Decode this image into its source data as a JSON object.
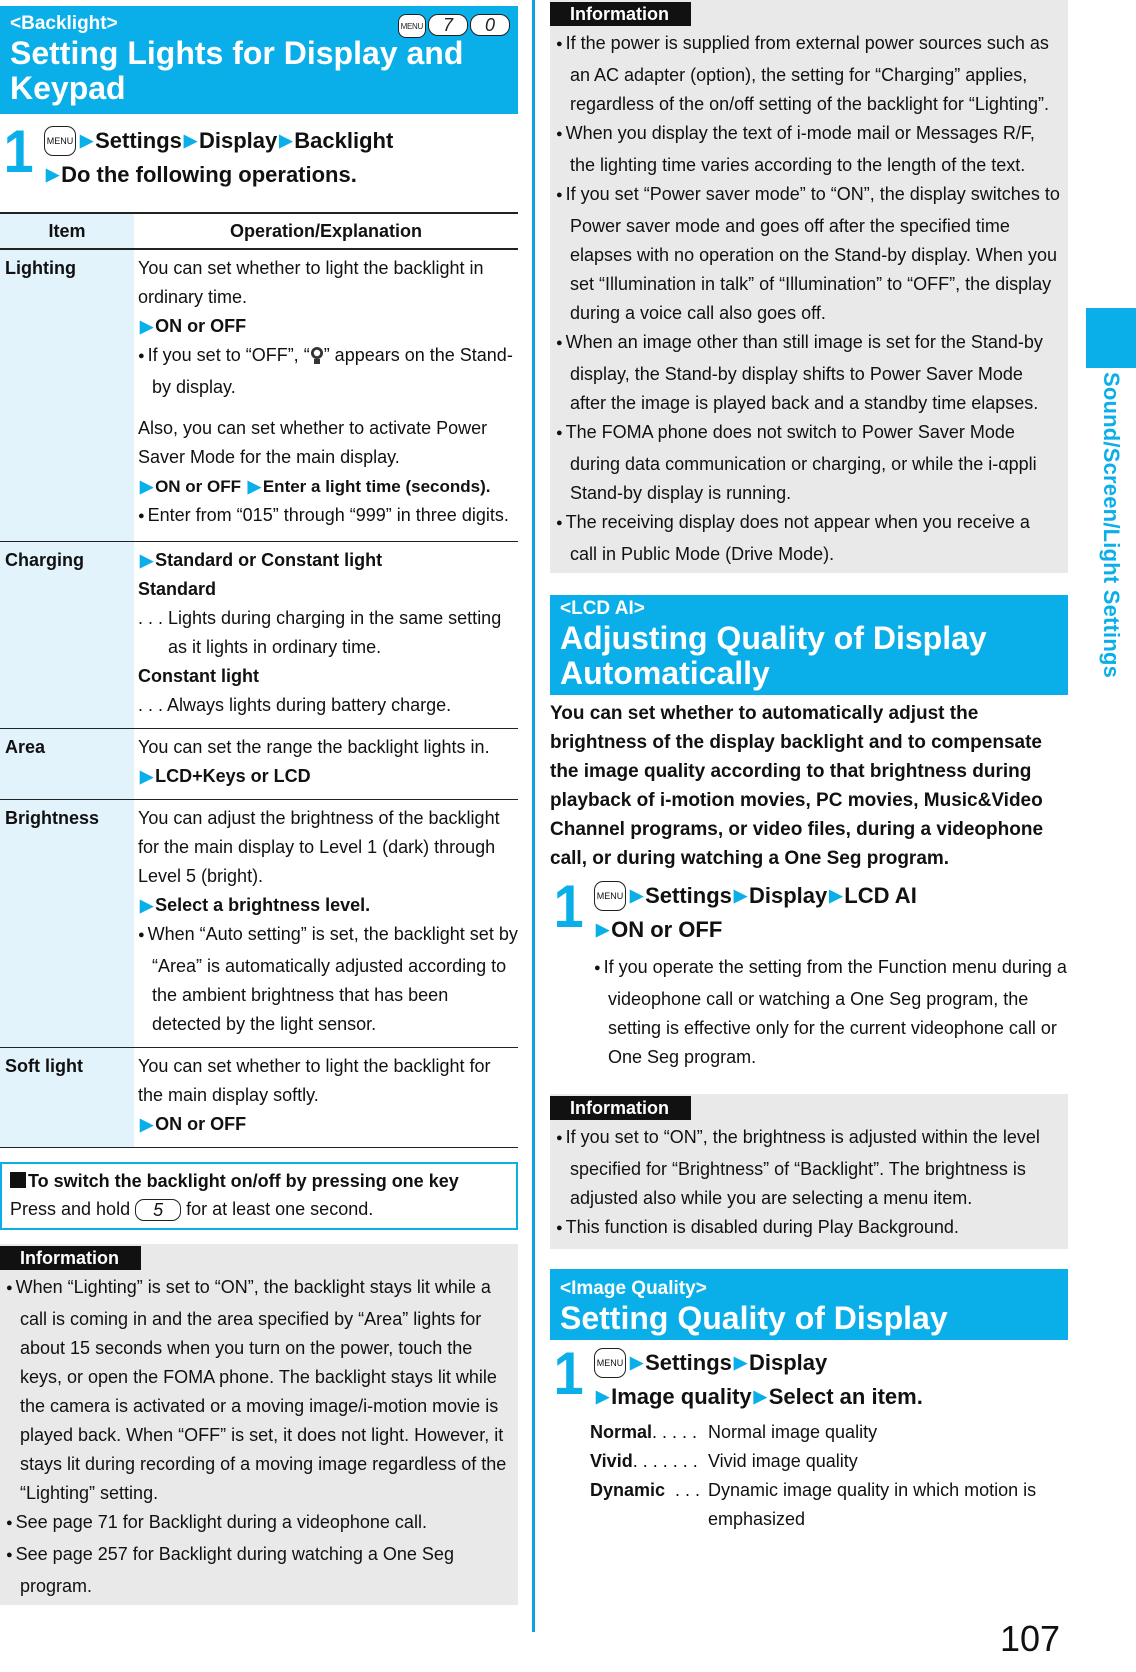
{
  "left": {
    "banner": {
      "tag": "<Backlight>",
      "title": "Setting Lights for Display and Keypad",
      "shortcut_keys": [
        "MENU",
        "7",
        "0"
      ]
    },
    "step": {
      "number": "1",
      "menu_key": "MENU",
      "path": [
        "Settings",
        "Display",
        "Backlight"
      ],
      "action": "Do the following operations."
    },
    "table": {
      "headers": [
        "Item",
        "Operation/Explanation"
      ],
      "rows": {
        "lighting": {
          "item": "Lighting",
          "desc1": "You can set whether to light the backlight in ordinary time.",
          "op1": "ON or OFF",
          "note1_before": "If you set to “OFF”, “",
          "note1_after": "” appears on the Stand-by display.",
          "desc2": "Also, you can set whether to activate Power Saver Mode for the main display.",
          "op2a": "ON or OFF",
          "op2b": "Enter a light time (seconds).",
          "note2": "Enter from “015” through “999” in three digits."
        },
        "charging": {
          "item": "Charging",
          "op": "Standard or Constant light",
          "opt1": "Standard",
          "opt1_desc": ". . . Lights during charging in the same setting as it lights in ordinary time.",
          "opt2": "Constant light",
          "opt2_desc": ". . . Always lights during battery charge."
        },
        "area": {
          "item": "Area",
          "desc": "You can set the range the backlight lights in.",
          "op": "LCD+Keys or LCD"
        },
        "brightness": {
          "item": "Brightness",
          "desc": "You can adjust the brightness of the backlight for the main display to Level 1 (dark) through Level 5 (bright).",
          "op": "Select a brightness level.",
          "note": "When “Auto setting” is set, the backlight set by “Area” is automatically adjusted according to the ambient brightness that has been detected by the light sensor."
        },
        "soft_light": {
          "item": "Soft light",
          "desc": "You can set whether to light the backlight for the main display softly.",
          "op": "ON or OFF"
        }
      }
    },
    "tip": {
      "heading": "To switch the backlight on/off by pressing one key",
      "before_key": "Press and hold",
      "key": "5",
      "after_key": "for at least one second."
    },
    "info": {
      "label": "Information",
      "bullets": [
        "When “Lighting” is set to “ON”, the backlight stays lit while a call is coming in and the area specified by “Area” lights for about 15 seconds when you turn on the power, touch the keys, or open the FOMA phone. The backlight stays lit while the camera is activated or a moving image/i-motion movie is played back. When “OFF” is set, it does not light. However, it stays lit during recording of a moving image regardless of the “Lighting” setting.",
        "See page 71 for Backlight during a videophone call.",
        "See page 257 for Backlight during watching a One Seg program."
      ]
    }
  },
  "right": {
    "info_top": {
      "label": "Information",
      "bullets": [
        "If the power is supplied from external power sources such as an AC adapter (option), the setting for “Charging” applies, regardless of the on/off setting of the backlight for “Lighting”.",
        "When you display the text of i-mode mail or Messages R/F, the lighting time varies according to the length of the text.",
        "If you set “Power saver mode” to “ON”, the display switches to Power saver mode and goes off after the specified time elapses with no operation on the Stand-by display. When you set “Illumination in talk” of “Illumination” to “OFF”, the display during a voice call also goes off.",
        "When an image other than still image is set for the Stand-by display, the Stand-by display shifts to Power Saver Mode after the image is played back and a standby time elapses.",
        "The FOMA phone does not switch to Power Saver Mode during data communication or charging, or while the i-αppli Stand-by display is running.",
        "The receiving display does not appear when you receive a call in Public Mode (Drive Mode)."
      ]
    },
    "lcd_ai": {
      "banner_tag": "<LCD AI>",
      "banner_title": "Adjusting Quality of Display Automatically",
      "intro": "You can set whether to automatically adjust the brightness of the display backlight and to compensate the image quality according to that brightness during playback of i-motion movies, PC movies, Music&Video Channel programs, or video files, during a videophone call, or during watching a One Seg program.",
      "step_number": "1",
      "menu_key": "MENU",
      "path": [
        "Settings",
        "Display",
        "LCD AI"
      ],
      "action": "ON or OFF",
      "note": "If you operate the setting from the Function menu during a videophone call or watching a One Seg program, the setting is effective only for the current videophone call or One Seg program."
    },
    "info_mid": {
      "label": "Information",
      "bullets": [
        "If you set to “ON”, the brightness is adjusted within the level specified for “Brightness” of “Backlight”. The brightness is adjusted also while you are selecting a menu item.",
        "This function is disabled during Play Background."
      ]
    },
    "image_quality": {
      "banner_tag": "<Image Quality>",
      "banner_title": "Setting Quality of Display",
      "step_number": "1",
      "menu_key": "MENU",
      "path": [
        "Settings",
        "Display"
      ],
      "path2": [
        "Image quality",
        "Select an item."
      ],
      "options": [
        {
          "name": "Normal",
          "dots": ". . . . .",
          "desc": "Normal image quality"
        },
        {
          "name": "Vivid",
          "dots": ". . . . . . .",
          "desc": "Vivid image quality"
        },
        {
          "name": "Dynamic",
          "dots": "  . . .",
          "desc": "Dynamic image quality in which motion is emphasized"
        }
      ]
    }
  },
  "side_label": "Sound/Screen/Light Settings",
  "page_number": "107",
  "colors": {
    "accent": "#0aaee8",
    "item_column_bg": "#e2f3fc",
    "info_bg": "#e9e9e9"
  }
}
